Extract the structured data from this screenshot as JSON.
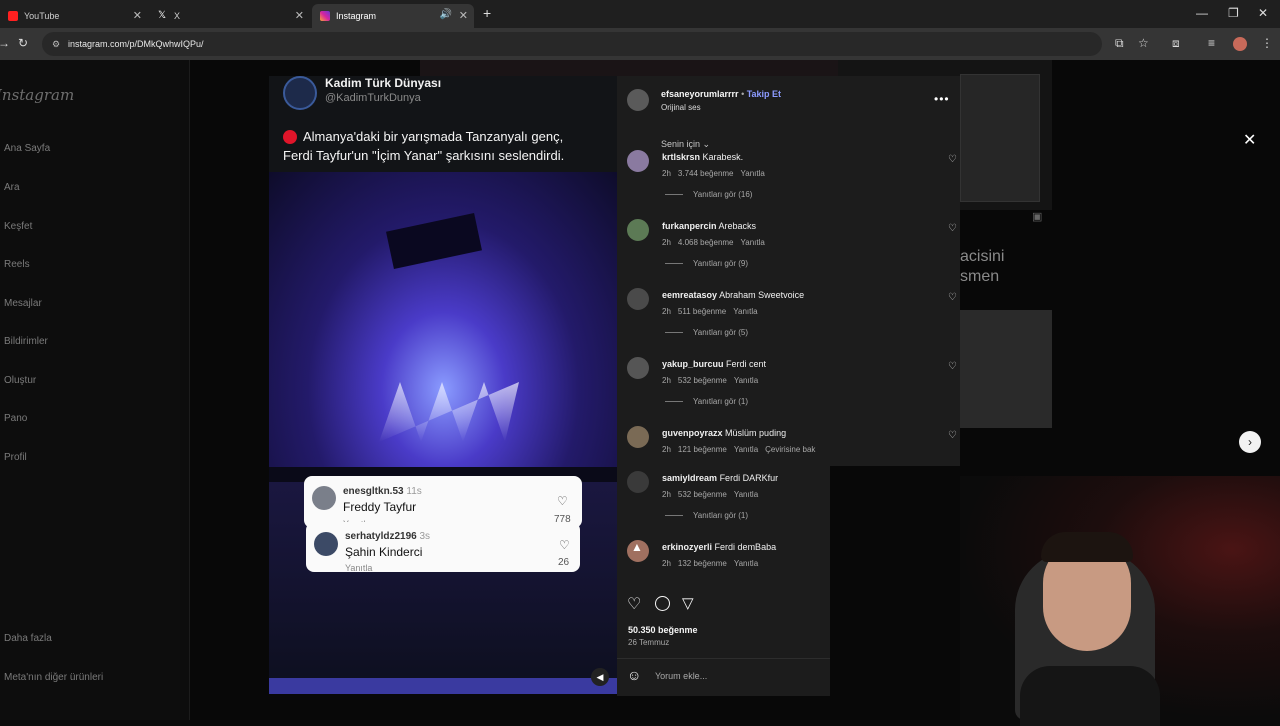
{
  "browser": {
    "tabs": [
      {
        "label": "YouTube",
        "active": false
      },
      {
        "label": "X",
        "active": false
      },
      {
        "label": "Instagram",
        "active": true
      }
    ],
    "url": "instagram.com/p/DMkQwhwIQPu/"
  },
  "sidebar": {
    "logo": "Instagram",
    "items": [
      "Ana Sayfa",
      "Ara",
      "Keşfet",
      "Reels",
      "Mesajlar",
      "Bildirimler",
      "Oluştur",
      "Pano",
      "Profil"
    ],
    "more": "Daha fazla",
    "meta": "Meta'nın diğer ürünleri"
  },
  "background": {
    "side_text_1": "acisini",
    "side_text_2": "smen"
  },
  "video": {
    "account_name": "Kadim Türk Dünyası",
    "account_handle": "@KadimTurkDunya",
    "caption_1": "Almanya'daki bir yarışmada Tanzanyalı genç,",
    "caption_2": "Ferdi Tayfur'un \"İçim Yanar\" şarkısını seslendirdi.",
    "comment_cards": [
      {
        "user": "enesgltkn.53",
        "time": "11s",
        "text": "Freddy Tayfur",
        "reply": "Yanıtla",
        "likes": "778"
      },
      {
        "user": "serhatyldz2196",
        "time": "3s",
        "text": "Şahin Kinderci",
        "reply": "Yanıtla",
        "likes": "26"
      }
    ]
  },
  "post": {
    "username": "efsaneyorumlarrrr",
    "follow": "Takip Et",
    "audio": "Orijinal ses",
    "sort_label": "Senin için",
    "comments": [
      {
        "user": "krtlskrsn",
        "text": "Karabesk.",
        "time": "2h",
        "likes": "3.744 beğenme",
        "reply": "Yanıtla",
        "extra": "",
        "replies": "Yanıtları gör (16)"
      },
      {
        "user": "furkanpercin",
        "text": "Arebacks",
        "time": "2h",
        "likes": "4.068 beğenme",
        "reply": "Yanıtla",
        "extra": "",
        "replies": "Yanıtları gör (9)"
      },
      {
        "user": "eemreatasoy",
        "text": "Abraham Sweetvoice",
        "time": "2h",
        "likes": "511 beğenme",
        "reply": "Yanıtla",
        "extra": "",
        "replies": "Yanıtları gör (5)"
      },
      {
        "user": "yakup_burcuu",
        "text": "Ferdi cent",
        "time": "2h",
        "likes": "532 beğenme",
        "reply": "Yanıtla",
        "extra": "",
        "replies": "Yanıtları gör (1)"
      },
      {
        "user": "guvenpoyrazx",
        "text": "Müslüm puding",
        "time": "2h",
        "likes": "121 beğenme",
        "reply": "Yanıtla",
        "extra": "Çevirisine bak",
        "replies": ""
      },
      {
        "user": "samiyldream",
        "text": "Ferdi DARKfur",
        "time": "2h",
        "likes": "532 beğenme",
        "reply": "Yanıtla",
        "extra": "",
        "replies": "Yanıtları gör (1)"
      },
      {
        "user": "erkinozyerli",
        "text": "Ferdi demBaba",
        "time": "2h",
        "likes": "132 beğenme",
        "reply": "Yanıtla",
        "extra": "",
        "replies": ""
      }
    ],
    "like_count": "50.350 beğenme",
    "date": "26 Temmuz",
    "comment_placeholder": "Yorum ekle..."
  },
  "colors": {
    "follow_blue": "#8c9bff",
    "panel_bg": "#1c1c1c"
  }
}
